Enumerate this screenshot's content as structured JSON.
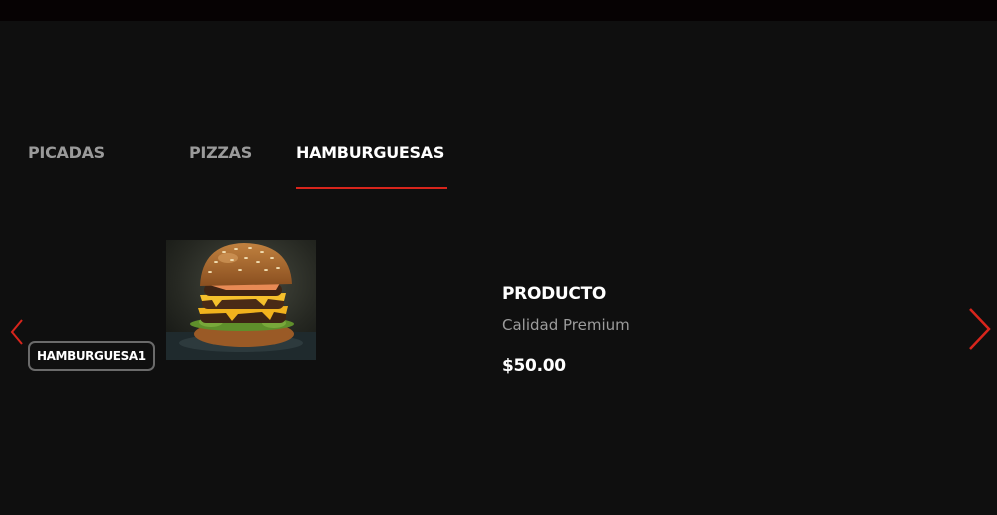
{
  "tabs": [
    {
      "label": "PICADAS",
      "active": false
    },
    {
      "label": "PIZZAS",
      "active": false
    },
    {
      "label": "HAMBURGUESAS",
      "active": true
    }
  ],
  "product": {
    "badge": "HAMBURGUESA1",
    "name": "PRODUCTO",
    "description": "Calidad Premium",
    "price": "$50.00",
    "image": "burger-photo"
  },
  "carousel": {
    "prev_icon": "chevron-left-icon",
    "next_icon": "chevron-right-icon"
  },
  "colors": {
    "background": "#0f0f0f",
    "topbar": "#060203",
    "accent": "#d8251c",
    "tab_inactive": "#9a9a9a",
    "text": "#ffffff",
    "muted": "#9c9c9c"
  }
}
